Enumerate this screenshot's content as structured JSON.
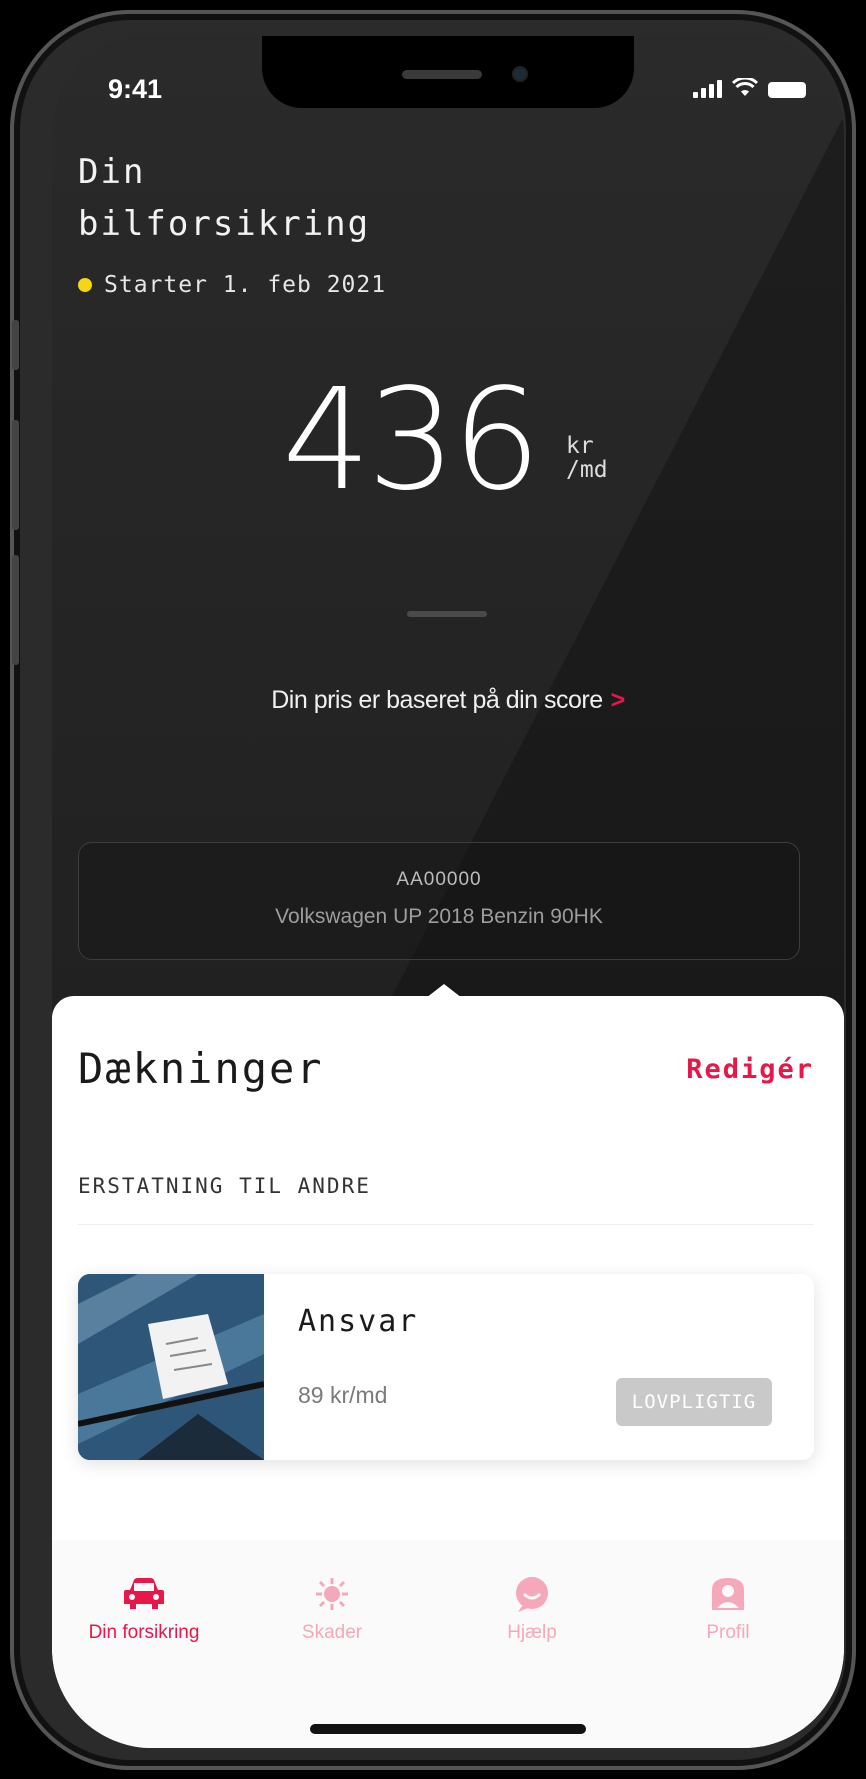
{
  "status": {
    "time": "9:41"
  },
  "header": {
    "title_line1": "Din",
    "title_line2": "bilforsikring",
    "start_text": "Starter 1. feb 2021"
  },
  "price": {
    "amount": "436",
    "unit_line1": "kr",
    "unit_line2": "/md",
    "based_text": "Din pris er baseret på din score",
    "chevron": ">"
  },
  "car": {
    "plate": "AA00000",
    "name": "Volkswagen UP 2018 Benzin 90HK"
  },
  "coverages": {
    "title": "Dækninger",
    "edit_label": "Redigér",
    "section_label": "ERSTATNING TIL ANDRE",
    "items": [
      {
        "name": "Ansvar",
        "price": "89 kr/md",
        "badge": "LOVPLIGTIG"
      }
    ]
  },
  "tabs": [
    {
      "label": "Din forsikring",
      "icon": "car-icon",
      "active": true
    },
    {
      "label": "Skader",
      "icon": "damage-icon",
      "active": false
    },
    {
      "label": "Hjælp",
      "icon": "chat-icon",
      "active": false
    },
    {
      "label": "Profil",
      "icon": "profile-icon",
      "active": false
    }
  ],
  "colors": {
    "accent": "#e8174a",
    "accent_light": "#f6a8bb",
    "status_dot": "#f5d617"
  }
}
